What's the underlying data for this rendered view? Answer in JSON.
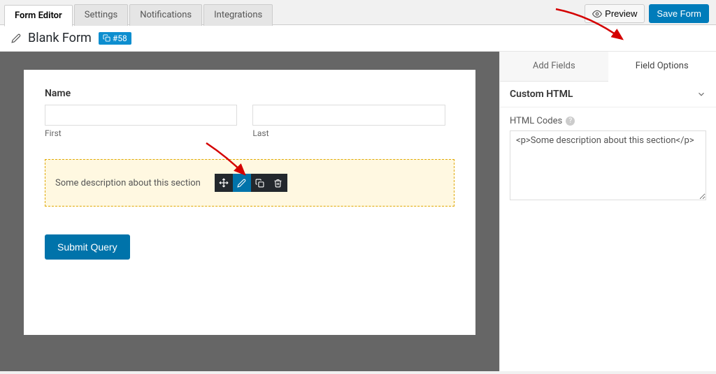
{
  "tabs": {
    "form_editor": "Form Editor",
    "settings": "Settings",
    "notifications": "Notifications",
    "integrations": "Integrations"
  },
  "top_actions": {
    "preview": "Preview",
    "save": "Save Form"
  },
  "header": {
    "title": "Blank Form",
    "id_badge": "#58"
  },
  "form": {
    "name_label": "Name",
    "first_label": "First",
    "last_label": "Last",
    "html_field_text": "Some description about this section",
    "submit_label": "Submit Query"
  },
  "right_panel": {
    "tab_add_fields": "Add Fields",
    "tab_field_options": "Field Options",
    "section_title": "Custom HTML",
    "html_codes_label": "HTML Codes",
    "textarea_value": "<p>Some description about this section</p>"
  }
}
